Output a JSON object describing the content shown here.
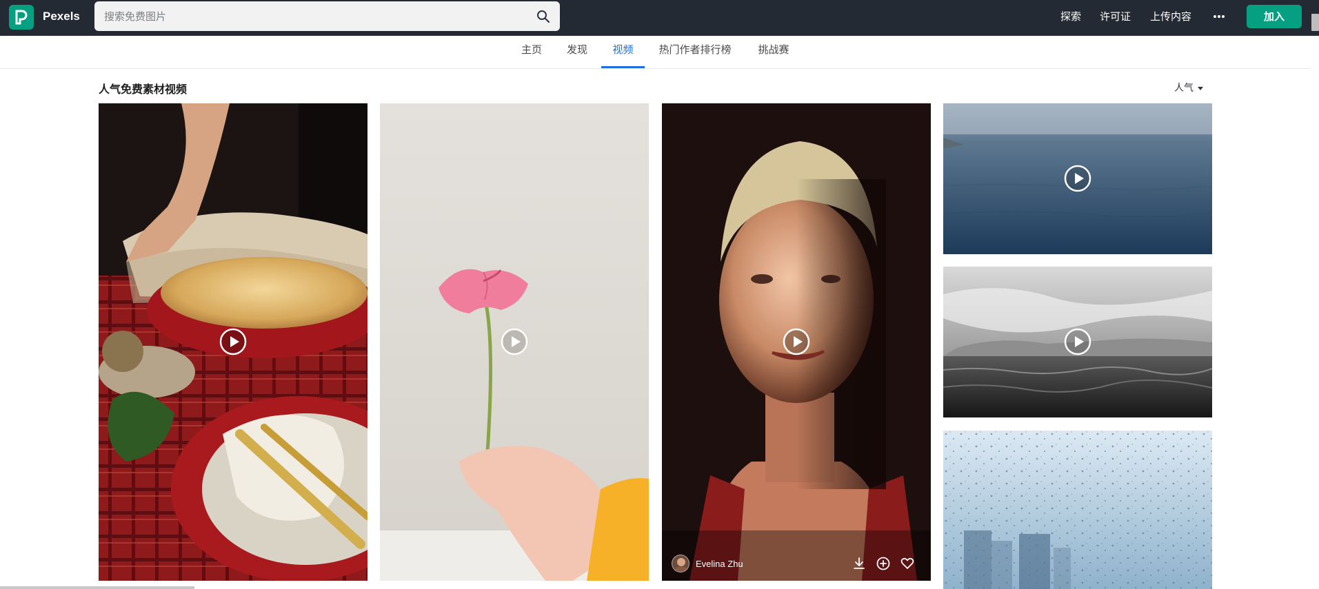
{
  "header": {
    "brand": "Pexels",
    "search_placeholder": "搜索免费图片",
    "nav": [
      "探索",
      "许可证",
      "上传内容"
    ],
    "more_icon": "more-horizontal-icon",
    "join_label": "加入",
    "accent": "#05a081"
  },
  "tabs": [
    {
      "label": "主页",
      "active": false
    },
    {
      "label": "发现",
      "active": false
    },
    {
      "label": "视频",
      "active": true
    },
    {
      "label": "热门作者排行榜",
      "active": false
    },
    {
      "label": "挑战赛",
      "active": false
    }
  ],
  "section": {
    "title": "人气免费素材视频",
    "sort_label": "人气"
  },
  "videos": [
    {
      "subject": "baked-dish-on-plaid-tablecloth"
    },
    {
      "subject": "pink-anthurium-flower-in-hand"
    },
    {
      "subject": "portrait-of-woman",
      "author": "Evelina Zhu"
    },
    {
      "subject": "calm-ocean"
    },
    {
      "subject": "black-and-white-sea"
    },
    {
      "subject": "raindrops-on-window"
    }
  ]
}
